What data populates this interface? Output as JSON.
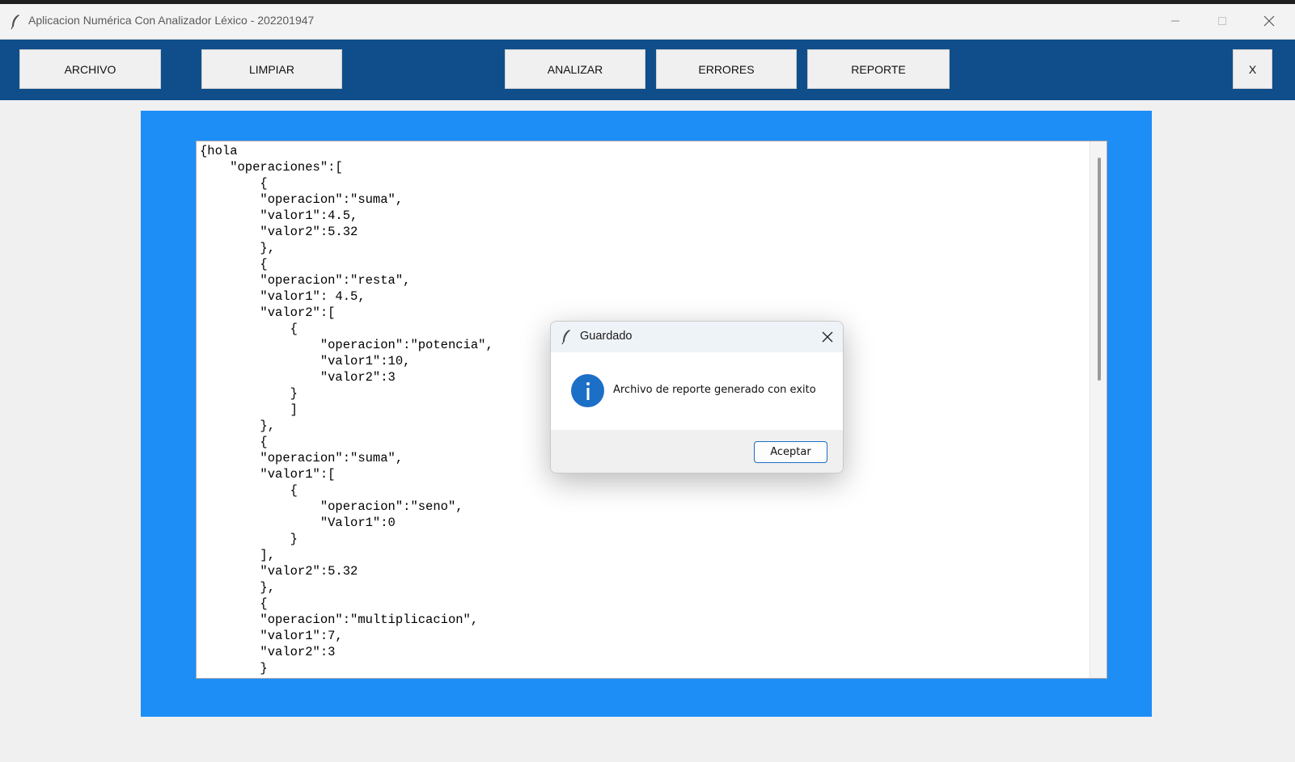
{
  "window": {
    "title": "Aplicacion Numérica Con Analizador Léxico - 202201947"
  },
  "toolbar": {
    "archivo_label": "ARCHIVO",
    "limpiar_label": "LIMPIAR",
    "analizar_label": "ANALIZAR",
    "errores_label": "ERRORES",
    "reporte_label": "REPORTE",
    "close_label": "X"
  },
  "editor": {
    "content": "{hola\n    \"operaciones\":[\n        {\n        \"operacion\":\"suma\",\n        \"valor1\":4.5,\n        \"valor2\":5.32\n        },\n        {\n        \"operacion\":\"resta\",\n        \"valor1\": 4.5,\n        \"valor2\":[\n            {\n                \"operacion\":\"potencia\",\n                \"valor1\":10,\n                \"valor2\":3\n            }\n            ]\n        },\n        {\n        \"operacion\":\"suma\",\n        \"valor1\":[\n            {\n                \"operacion\":\"seno\",\n                \"Valor1\":0\n            }\n        ],\n        \"valor2\":5.32\n        },\n        {\n        \"operacion\":\"multiplicacion\",\n        \"valor1\":7,\n        \"valor2\":3\n        }"
  },
  "dialog": {
    "title": "Guardado",
    "icon": "info-icon",
    "message": "Archivo de reporte generado con exito",
    "ok_label": "Aceptar"
  },
  "colors": {
    "toolbar": "#0f4e8a",
    "frame": "#1e8ef7",
    "accent": "#1c6fc7"
  }
}
